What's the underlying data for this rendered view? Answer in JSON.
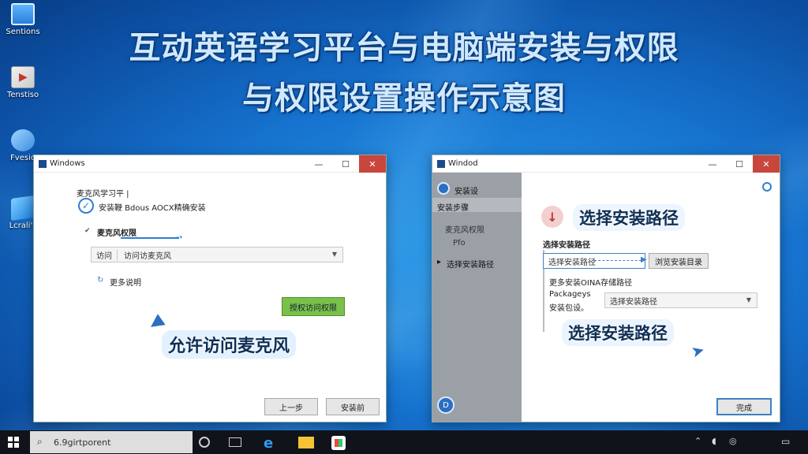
{
  "headline": {
    "line1": "互动英语学习平台与电脑端安装与权限",
    "line2": "与权限设置操作示意图"
  },
  "desktop_icons": [
    {
      "label": "Sentions",
      "icon": "monitor-icon"
    },
    {
      "label": "Tenstiso",
      "icon": "media-icon"
    },
    {
      "label": "Fvesio",
      "icon": "network-icon"
    },
    {
      "label": "Lcrali's",
      "icon": "windows-icon"
    }
  ],
  "left_window": {
    "title": "Windows",
    "section_label": "麦克风学习平 |",
    "check_text": "安装鞭 Bdous AOCX精确安装",
    "subsection": "麦克风权限",
    "combo_prefix": "访问",
    "combo_value": "访问访麦克风",
    "info_text": "更多说明",
    "grant_button": "授权访问权限",
    "callout": "允许访问麦克风",
    "btn_prev": "上一步",
    "btn_next": "安装前"
  },
  "right_window": {
    "title": "Windod",
    "sidebar_header": "安装设",
    "sidebar_sub": "安装步骤",
    "sidebar_item1": "麦克风权限",
    "sidebar_item2": "Pfo",
    "sidebar_item3": "选择安装路径",
    "callout_top": "选择安装路径",
    "section": "选择安装路径",
    "path_value": "选择安装路径",
    "browse_button": "浏览安装目录",
    "desc": "更多安装OINA存储路径",
    "pkg_label1": "Packageys",
    "pkg_label2": "安装包设。",
    "pkg_combo": "选择安装路径",
    "callout_bottom": "选择安装路径",
    "finish_button": "完成"
  },
  "taskbar": {
    "search_text": "6.9girtporent"
  }
}
